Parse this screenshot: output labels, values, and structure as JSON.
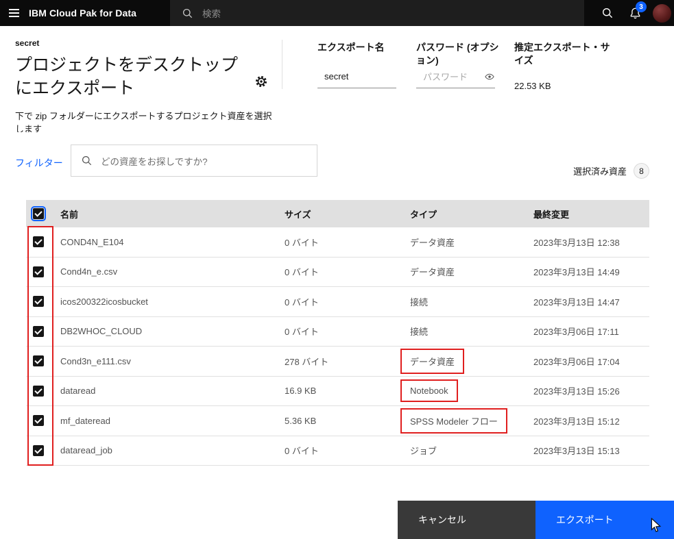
{
  "topbar": {
    "title": "IBM Cloud Pak for Data",
    "search_placeholder": "検索",
    "notification_count": "3"
  },
  "header": {
    "project_name": "secret",
    "title": "プロジェクトをデスクトップにエクスポート",
    "subtitle": "下で zip フォルダーにエクスポートするプロジェクト資産を選択します",
    "fields": {
      "export_name": {
        "label": "エクスポート名",
        "value": "secret"
      },
      "password": {
        "label": "パスワード (オプション)",
        "placeholder": "パスワード"
      },
      "estimated_size": {
        "label": "推定エクスポート・サイズ",
        "value": "22.53 KB"
      }
    }
  },
  "filter": {
    "link_label": "フィルター",
    "search_placeholder": "どの資産をお探しですか?",
    "selected_label": "選択済み資産",
    "selected_count": "8"
  },
  "table": {
    "headers": [
      "名前",
      "サイズ",
      "タイプ",
      "最終変更"
    ],
    "rows": [
      {
        "name": "COND4N_E104",
        "size": "0 バイト",
        "type": "データ資産",
        "modified": "2023年3月13日 12:38",
        "type_highlight": false
      },
      {
        "name": "Cond4n_e.csv",
        "size": "0 バイト",
        "type": "データ資産",
        "modified": "2023年3月13日 14:49",
        "type_highlight": false
      },
      {
        "name": "icos200322icosbucket",
        "size": "0 バイト",
        "type": "接続",
        "modified": "2023年3月13日 14:47",
        "type_highlight": false
      },
      {
        "name": "DB2WHOC_CLOUD",
        "size": "0 バイト",
        "type": "接続",
        "modified": "2023年3月06日 17:11",
        "type_highlight": false
      },
      {
        "name": "Cond3n_e111.csv",
        "size": "278 バイト",
        "type": "データ資産",
        "modified": "2023年3月06日 17:04",
        "type_highlight": true
      },
      {
        "name": "dataread",
        "size": "16.9 KB",
        "type": "Notebook",
        "modified": "2023年3月13日 15:26",
        "type_highlight": true
      },
      {
        "name": "mf_dateread",
        "size": "5.36 KB",
        "type": "SPSS Modeler フロー",
        "modified": "2023年3月13日 15:12",
        "type_highlight": true
      },
      {
        "name": "dataread_job",
        "size": "0 バイト",
        "type": "ジョブ",
        "modified": "2023年3月13日 15:13",
        "type_highlight": false
      }
    ]
  },
  "footer": {
    "cancel_label": "キャンセル",
    "export_label": "エクスポート"
  },
  "colors": {
    "accent": "#0f62fe",
    "annotation_red": "#e01e1e"
  }
}
